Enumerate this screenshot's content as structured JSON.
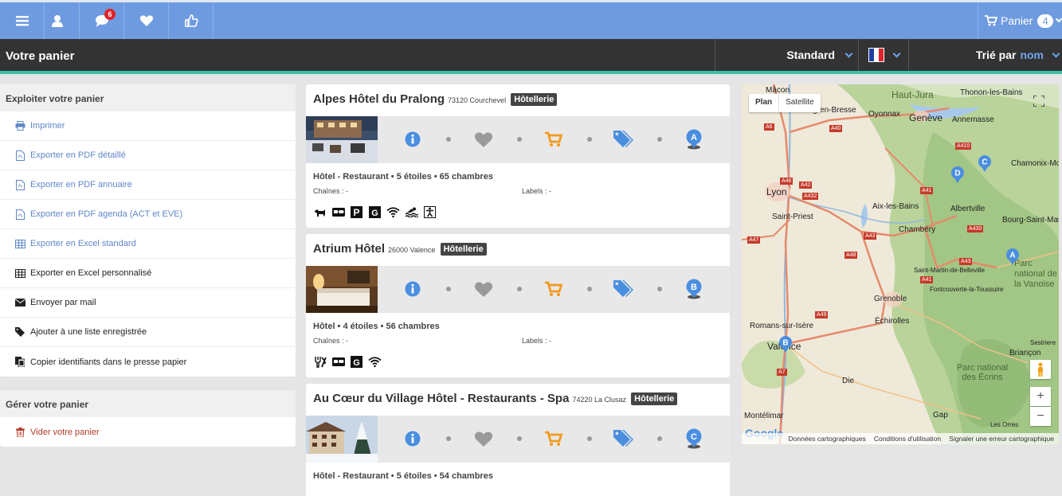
{
  "topbar": {
    "notifications_count": "6",
    "cart_label": "Panier",
    "cart_count": "4"
  },
  "header": {
    "title": "Votre panier",
    "view_mode": "Standard",
    "sort_prefix": "Trié par",
    "sort_field": "nom"
  },
  "exploit_panel": {
    "title": "Exploiter votre panier",
    "items": [
      {
        "label": "Imprimer",
        "icon": "print-icon"
      },
      {
        "label": "Exporter en PDF détaillé",
        "icon": "pdf-icon"
      },
      {
        "label": "Exporter en PDF annuaire",
        "icon": "pdf-icon"
      },
      {
        "label": "Exporter en PDF agenda (ACT et EVE)",
        "icon": "pdf-icon"
      },
      {
        "label": "Exporter en Excel standard",
        "icon": "table-icon"
      },
      {
        "label": "Exporter en Excel personnalisé",
        "icon": "table-icon"
      },
      {
        "label": "Envoyer par mail",
        "icon": "envelope-icon"
      },
      {
        "label": "Ajouter à une liste enregistrée",
        "icon": "tag-icon"
      },
      {
        "label": "Copier identifiants dans le presse papier",
        "icon": "clipboard-icon"
      }
    ]
  },
  "manage_panel": {
    "title": "Gérer votre panier",
    "items": [
      {
        "label": "Vider votre panier",
        "icon": "trash-icon"
      }
    ]
  },
  "cards": [
    {
      "name": "Alpes Hôtel du Pralong",
      "location": "73120 Courchevel",
      "category": "Hôtellerie",
      "marker": "A",
      "description": "Hôtel - Restaurant • 5 étoiles • 65 chambres",
      "chains_label": "Chaînes : -",
      "labels_label": "Labels : -",
      "features": [
        "pets-icon",
        "credit-card-icon",
        "parking-icon",
        "gps-icon",
        "wifi-icon",
        "pool-icon",
        "accessibility-icon"
      ]
    },
    {
      "name": "Atrium Hôtel",
      "location": "26000 Valence",
      "category": "Hôtellerie",
      "marker": "B",
      "description": "Hôtel • 4 étoiles • 56 chambres",
      "chains_label": "Chaînes : -",
      "labels_label": "Labels : -",
      "features": [
        "restaurant-icon",
        "credit-card-icon",
        "gps-icon",
        "wifi-icon"
      ]
    },
    {
      "name": "Au Cœur du Village Hôtel - Restaurants - Spa",
      "location": "74220 La Clusaz",
      "category": "Hôtellerie",
      "marker": "C",
      "description": "Hôtel - Restaurant • 5 étoiles • 54 chambres"
    }
  ],
  "map": {
    "tab_plan": "Plan",
    "tab_satellite": "Satellite",
    "footer": {
      "data": "Données cartographiques",
      "terms": "Conditions d'utilisation",
      "report": "Signaler une erreur cartographique"
    },
    "cities": [
      "Mâcon",
      "Haut-Jura",
      "Thonon-les-Bains",
      "Bourg-en-Bresse",
      "Oyonnax",
      "Genève",
      "Annemasse",
      "Chamonix-Mont",
      "Lyon",
      "Saint-Priest",
      "Aix-les-Bains",
      "Albertville",
      "Bourg-Saint-Maur",
      "Chambéry",
      "Parc national de la Vanoise",
      "Saint-Martin-de-Belleville",
      "Fontcouverte-la-Toussuire",
      "Grenoble",
      "Échirolles",
      "Romans-sur-Isère",
      "Valence",
      "Briançon",
      "Sestriere",
      "Parc national des Écrins",
      "Die",
      "Gap",
      "Montélimar",
      "Les Orres",
      "Google"
    ],
    "routes": [
      "A6",
      "A40",
      "A410",
      "A46",
      "A42",
      "A432",
      "A41",
      "A430",
      "A47",
      "A43",
      "A48",
      "A41",
      "A49",
      "A7",
      "A43"
    ],
    "markers": [
      "A",
      "B",
      "C",
      "D"
    ]
  }
}
